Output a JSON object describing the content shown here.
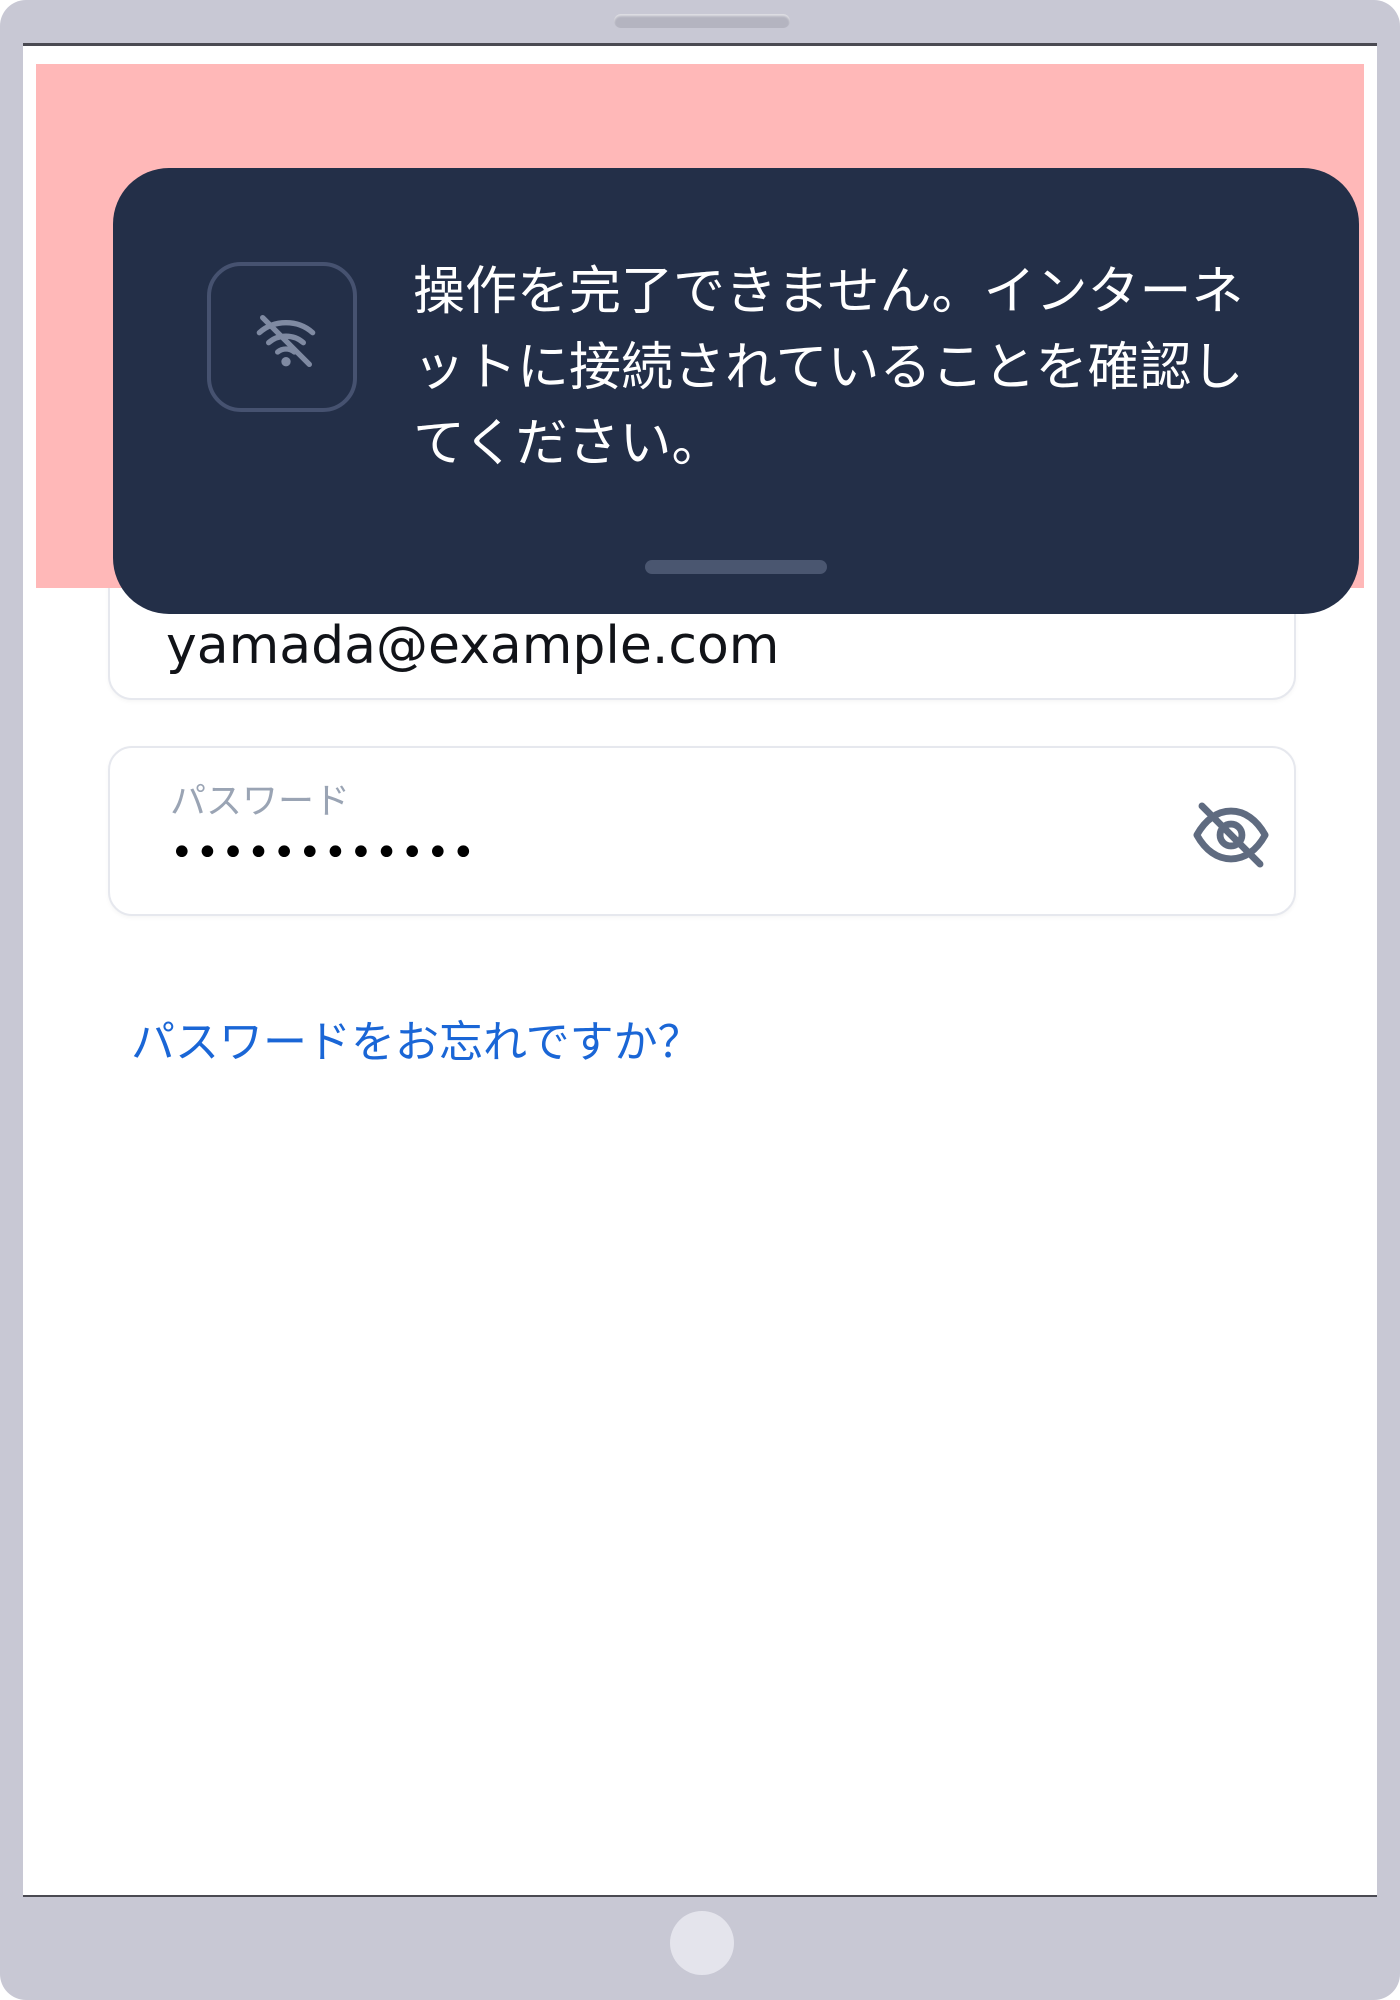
{
  "toast": {
    "icon": "wifi-off-icon",
    "message": "操作を完了できません。インターネットに接続されていることを確認してください。"
  },
  "form": {
    "email": {
      "value": "yamada@example.com"
    },
    "password": {
      "label": "パスワード",
      "masked_value": "••••••••••••",
      "toggle_icon": "eye-off-icon"
    },
    "forgot_link": "パスワードをお忘れですか？"
  },
  "colors": {
    "toast_background": "#232f48",
    "link": "#1a66d6",
    "highlight": "#ffb8b8"
  }
}
